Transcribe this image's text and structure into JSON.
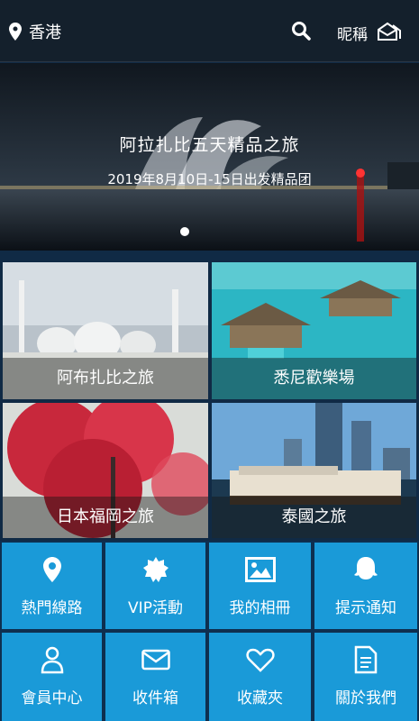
{
  "header": {
    "location": "香港",
    "nickname": "昵稱"
  },
  "banner": {
    "title": "阿拉扎比五天精品之旅",
    "subtitle": "2019年8月10日-15日出发精品团"
  },
  "destinations": [
    {
      "label": "阿布扎比之旅"
    },
    {
      "label": "悉尼歡樂場"
    },
    {
      "label": "日本福岡之旅"
    },
    {
      "label": "泰國之旅"
    }
  ],
  "menu": [
    {
      "label": "熱門線路",
      "icon": "location-pin-icon"
    },
    {
      "label": "VIP活動",
      "icon": "badge-icon"
    },
    {
      "label": "我的相冊",
      "icon": "picture-icon"
    },
    {
      "label": "提示通知",
      "icon": "ghost-icon"
    },
    {
      "label": "會員中心",
      "icon": "user-icon"
    },
    {
      "label": "收件箱",
      "icon": "envelope-icon"
    },
    {
      "label": "收藏夾",
      "icon": "heart-icon"
    },
    {
      "label": "關於我們",
      "icon": "document-icon"
    }
  ],
  "colors": {
    "accent": "#1a9ad8",
    "topbar": "#14202c",
    "background": "#102a45"
  }
}
